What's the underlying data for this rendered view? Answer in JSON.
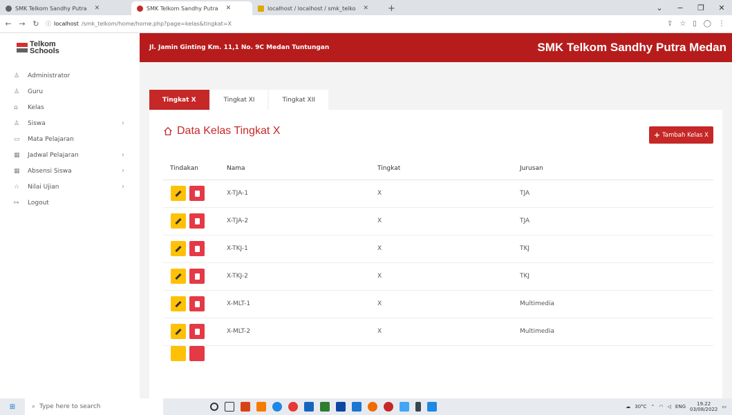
{
  "browser": {
    "tabs": [
      {
        "label": "SMK Telkom Sandhy Putra",
        "active": false
      },
      {
        "label": "SMK Telkom Sandhy Putra",
        "active": true
      },
      {
        "label": "localhost / localhost / smk_telko",
        "active": false
      }
    ],
    "url_host": "localhost",
    "url_path": "/smk_telkom/home/home.php?page=kelas&tingkat=X"
  },
  "header": {
    "logo_line1": "Telkom",
    "logo_line2": "Schools",
    "address": "Jl. Jamin Ginting Km. 11,1 No. 9C Medan Tuntungan",
    "school_name": "SMK Telkom Sandhy Putra Medan"
  },
  "sidebar": {
    "items": [
      {
        "label": "Administrator",
        "icon": "user-icon",
        "has_sub": false
      },
      {
        "label": "Guru",
        "icon": "users-icon",
        "has_sub": false
      },
      {
        "label": "Kelas",
        "icon": "home-icon",
        "has_sub": false
      },
      {
        "label": "Siswa",
        "icon": "users-icon",
        "has_sub": true
      },
      {
        "label": "Mata Pelajaran",
        "icon": "book-icon",
        "has_sub": false
      },
      {
        "label": "Jadwal Pelajaran",
        "icon": "table-icon",
        "has_sub": true
      },
      {
        "label": "Absensi Siswa",
        "icon": "table-icon",
        "has_sub": true
      },
      {
        "label": "Nilai Ujian",
        "icon": "star-icon",
        "has_sub": true
      },
      {
        "label": "Logout",
        "icon": "logout-icon",
        "has_sub": false
      }
    ]
  },
  "main": {
    "tabs": [
      "Tingkat X",
      "Tingkat XI",
      "Tingkat XII"
    ],
    "active_tab": 0,
    "title": "Data Kelas Tingkat X",
    "add_button": "Tambah Kelas X",
    "table": {
      "headers": [
        "Tindakan",
        "Nama",
        "Tingkat",
        "Jurusan"
      ],
      "rows": [
        {
          "nama": "X-TJA-1",
          "tingkat": "X",
          "jurusan": "TJA"
        },
        {
          "nama": "X-TJA-2",
          "tingkat": "X",
          "jurusan": "TJA"
        },
        {
          "nama": "X-TKJ-1",
          "tingkat": "X",
          "jurusan": "TKJ"
        },
        {
          "nama": "X-TKJ-2",
          "tingkat": "X",
          "jurusan": "TKJ"
        },
        {
          "nama": "X-MLT-1",
          "tingkat": "X",
          "jurusan": "Multimedia"
        },
        {
          "nama": "X-MLT-2",
          "tingkat": "X",
          "jurusan": "Multimedia"
        }
      ]
    }
  },
  "taskbar": {
    "search_placeholder": "Type here to search",
    "weather": "30°C",
    "lang": "ENG",
    "time": "19.22",
    "date": "03/08/2022"
  },
  "colors": {
    "brand": "#c62828",
    "edit": "#ffc107",
    "delete": "#e53946"
  }
}
